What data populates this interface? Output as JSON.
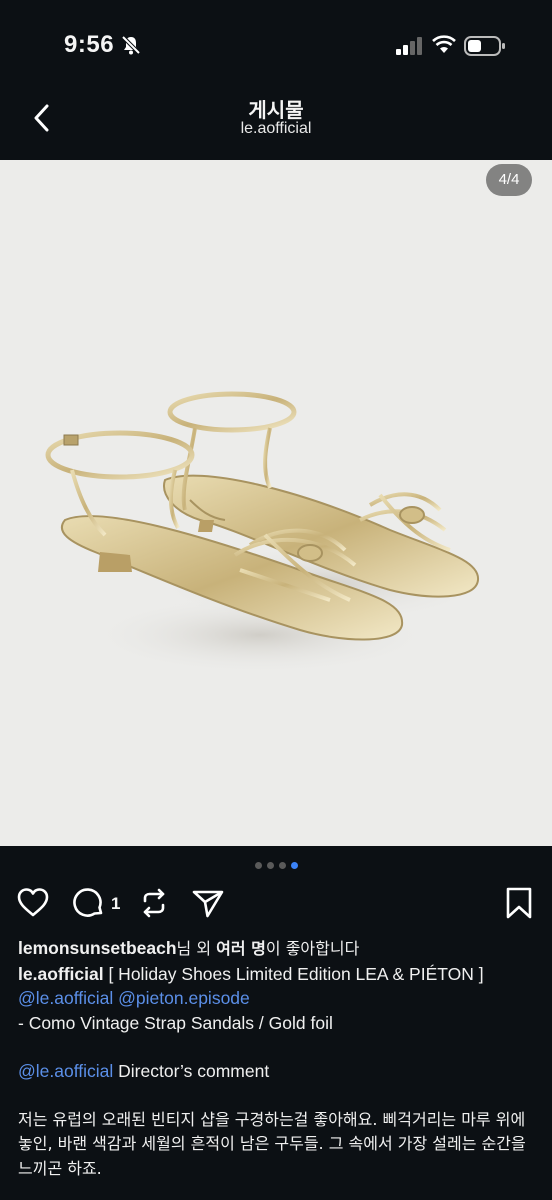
{
  "status_bar": {
    "time": "9:56"
  },
  "header": {
    "title": "게시물",
    "subtitle": "le.aofficial"
  },
  "image": {
    "counter": "4/4",
    "total_slides": 4,
    "active_slide": 4
  },
  "actions": {
    "comment_count": "1"
  },
  "likes": {
    "user": "lemonsunsetbeach",
    "mid1": "님 외 ",
    "bold": "여러 명",
    "mid2": "이 좋아합니다"
  },
  "caption": {
    "author": "le.aofficial",
    "text1": " [ Holiday Shoes Limited Edition LEA & PIÉTON ]",
    "mention1": "@le.aofficial",
    "mention2": "@pieton.episode",
    "line3": "- Como Vintage Strap Sandals / Gold foil",
    "mention3": "@le.aofficial",
    "line4": " Director’s comment",
    "korean": "저는 유럽의 오래된 빈티지 샵을 구경하는걸 좋아해요. 삐걱거리는 마루 위에 놓인, 바랜 색감과 세월의 흔적이 남은 구두들. 그 속에서 가장 설레는 순간을 느끼곤 하죠."
  },
  "colors": {
    "background": "#0c1014",
    "mention": "#5b8fe8",
    "active_dot": "#3b82f6",
    "image_bg": "#ececea"
  }
}
